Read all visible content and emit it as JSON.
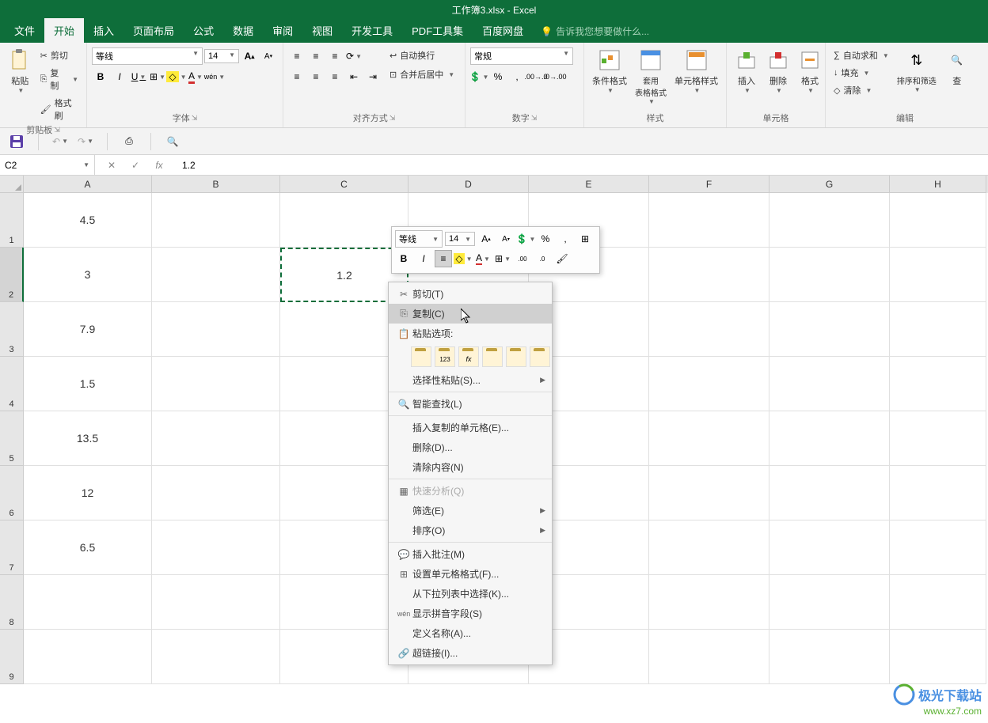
{
  "titlebar": {
    "title": "工作簿3.xlsx - Excel"
  },
  "tabs": {
    "items": [
      "文件",
      "开始",
      "插入",
      "页面布局",
      "公式",
      "数据",
      "审阅",
      "视图",
      "开发工具",
      "PDF工具集",
      "百度网盘"
    ],
    "active": 1,
    "tell_me": "告诉我您想要做什么..."
  },
  "ribbon": {
    "clipboard": {
      "label": "剪贴板",
      "paste": "粘贴",
      "cut": "剪切",
      "copy": "复制",
      "format_painter": "格式刷"
    },
    "font": {
      "label": "字体",
      "name": "等线",
      "size": "14"
    },
    "alignment": {
      "label": "对齐方式",
      "wrap": "自动换行",
      "merge": "合并后居中"
    },
    "number": {
      "label": "数字",
      "format": "常规"
    },
    "styles": {
      "label": "样式",
      "conditional": "条件格式",
      "table": "套用\n表格格式",
      "cell": "单元格样式"
    },
    "cells": {
      "label": "单元格",
      "insert": "插入",
      "delete": "删除",
      "format": "格式"
    },
    "editing": {
      "label": "编辑",
      "autosum": "自动求和",
      "fill": "填充",
      "clear": "清除",
      "sort": "排序和筛选",
      "find": "查"
    }
  },
  "formula_bar": {
    "cell_ref": "C2",
    "value": "1.2"
  },
  "grid": {
    "columns": [
      "A",
      "B",
      "C",
      "D",
      "E",
      "F",
      "G",
      "H"
    ],
    "rows": [
      {
        "num": "1",
        "A": "4.5"
      },
      {
        "num": "2",
        "A": "3",
        "C": "1.2"
      },
      {
        "num": "3",
        "A": "7.9"
      },
      {
        "num": "4",
        "A": "1.5"
      },
      {
        "num": "5",
        "A": "13.5"
      },
      {
        "num": "6",
        "A": "12"
      },
      {
        "num": "7",
        "A": "6.5"
      },
      {
        "num": "8"
      },
      {
        "num": "9"
      }
    ]
  },
  "mini_toolbar": {
    "font": "等线",
    "size": "14"
  },
  "context_menu": {
    "cut": "剪切(T)",
    "copy": "复制(C)",
    "paste_options": "粘贴选项:",
    "paste_fx": "fx",
    "paste_123": "123",
    "paste_special": "选择性粘贴(S)...",
    "smart_lookup": "智能查找(L)",
    "insert_copied": "插入复制的单元格(E)...",
    "delete": "删除(D)...",
    "clear_contents": "清除内容(N)",
    "quick_analysis": "快速分析(Q)",
    "filter": "筛选(E)",
    "sort": "排序(O)",
    "insert_comment": "插入批注(M)",
    "format_cells": "设置单元格格式(F)...",
    "pick_dropdown": "从下拉列表中选择(K)...",
    "show_pinyin": "显示拼音字段(S)",
    "define_name": "定义名称(A)...",
    "hyperlink": "超链接(I)..."
  },
  "watermark": {
    "name": "极光下载站",
    "url": "www.xz7.com"
  }
}
